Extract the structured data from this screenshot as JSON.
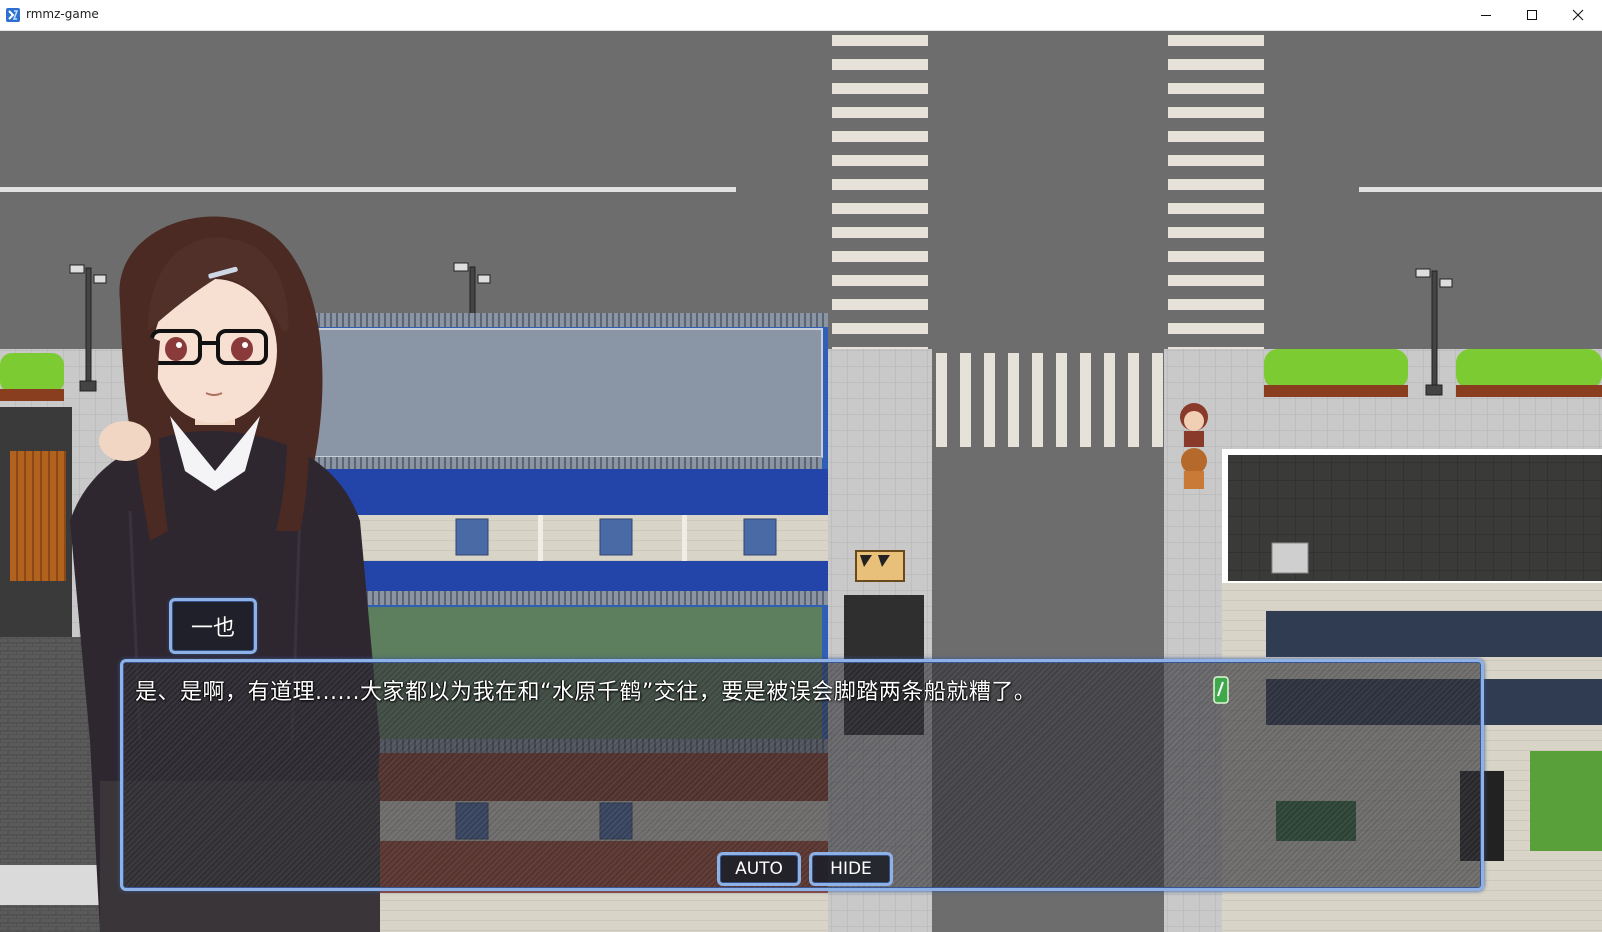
{
  "window": {
    "title": "rmmz-game",
    "icon": "app-icon",
    "controls": [
      "minimize-icon",
      "maximize-icon",
      "close-icon"
    ]
  },
  "dialogue": {
    "speaker": "一也",
    "message": "是、是啊，有道理......大家都以为我在和“水原千鹤”交往，要是被误会脚踏两条船就糟了。",
    "auto_label": "AUTO",
    "hide_label": "HIDE",
    "pause_icon": "pause-cursor-icon"
  },
  "colors": {
    "window_border": "#8eb2e6",
    "window_back": "#2d2d34",
    "road": "#6d6d6d",
    "sidewalk": "#c9c9c9"
  }
}
